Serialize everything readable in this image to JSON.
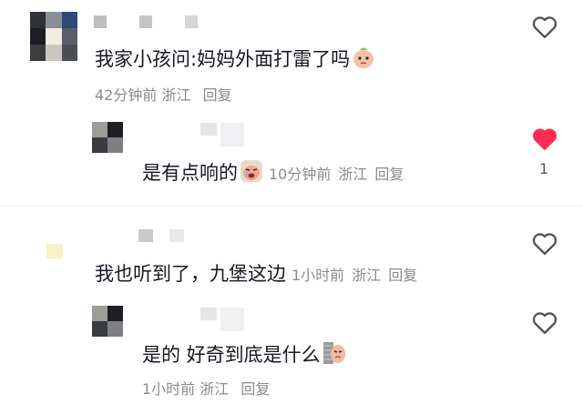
{
  "comments": [
    {
      "text": "我家小孩问:妈妈外面打雷了吗",
      "emoji": "peach-sad-emoji",
      "time": "42分钟前",
      "location": "浙江",
      "reply": "回复",
      "like_state": "unliked",
      "replies": [
        {
          "text": "是有点响的",
          "emoji": "crying-emoji",
          "time": "10分钟前",
          "location": "浙江",
          "reply": "回复",
          "like_state": "liked",
          "like_count": "1"
        }
      ]
    },
    {
      "text": "我也听到了，九堡这边",
      "time": "1小时前",
      "location": "浙江",
      "reply": "回复",
      "like_state": "unliked",
      "replies": [
        {
          "text": "是的 好奇到底是什么",
          "emoji": "peeking-emoji",
          "time": "1小时前",
          "location": "浙江",
          "reply": "回复",
          "like_state": "unliked"
        }
      ]
    }
  ],
  "colors": {
    "like_active": "#fe2c55",
    "like_inactive": "#555555",
    "meta": "#8a8b91"
  }
}
